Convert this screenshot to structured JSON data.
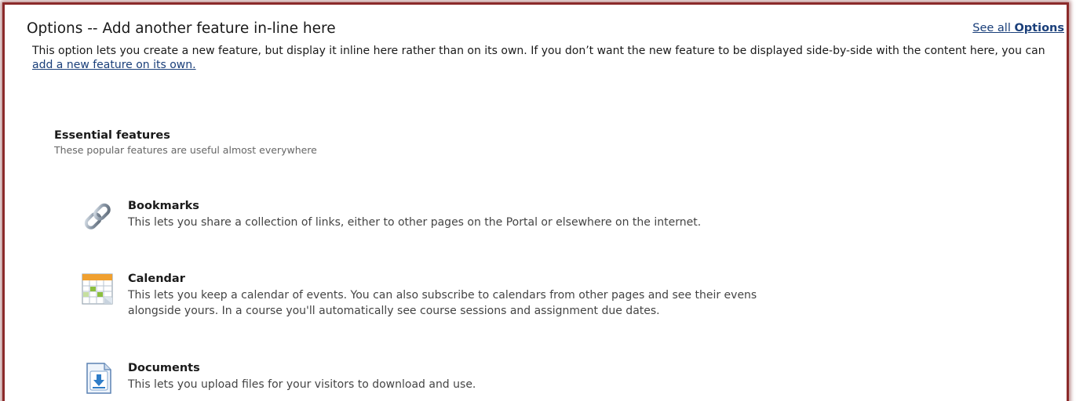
{
  "header": {
    "title": "Options -- Add another feature in-line here",
    "see_all_prefix": "See all",
    "see_all_bold": "Options"
  },
  "description": {
    "text": "This option lets you create a new feature, but display it inline here rather than on its own. If you don’t want the new feature to be displayed side-by-side with the content here, you can ",
    "link": "add a new feature on its own."
  },
  "section": {
    "title": "Essential features",
    "subtitle": "These popular features are useful almost everywhere"
  },
  "features": [
    {
      "icon": "link-chain-icon",
      "title": "Bookmarks",
      "description": "This lets you share a collection of links, either to other pages on the Portal or elsewhere on the internet."
    },
    {
      "icon": "calendar-icon",
      "title": "Calendar",
      "description_line1": "This lets you keep a calendar of events. You can also subscribe to calendars from other pages and see their evens",
      "description_line2": "alongside yours. In a course you'll automatically see course sessions and assignment due dates."
    },
    {
      "icon": "document-download-icon",
      "title": "Documents",
      "description": "This lets you upload files for your visitors to download and use."
    }
  ],
  "colors": {
    "frame_border": "#8b2a2a",
    "link": "#1a3f7a",
    "text": "#1a1a1a",
    "muted_text": "#666666",
    "calendar_header": "#f0a030",
    "calendar_cell_green": "#8cbf3f"
  }
}
